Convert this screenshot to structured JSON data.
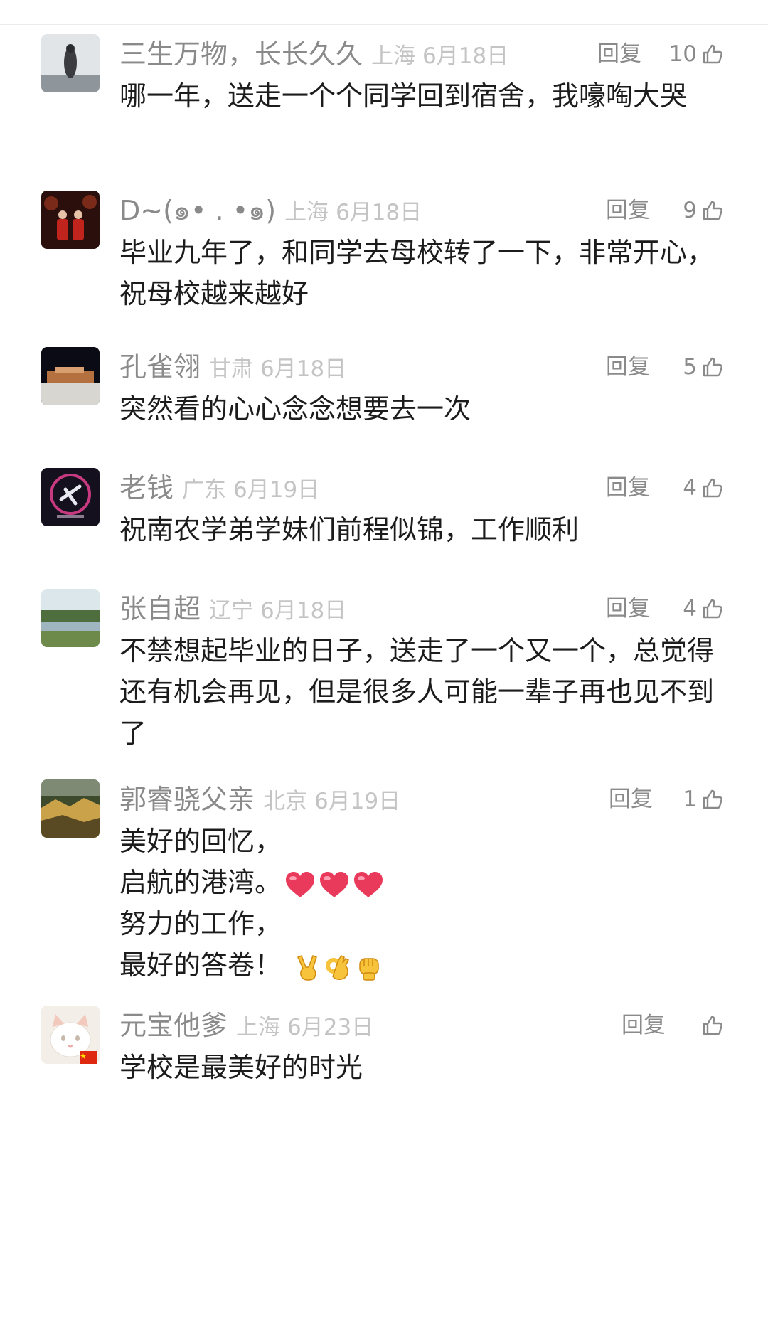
{
  "comments": [
    {
      "username": "三生万物，长长久久",
      "location": "上海",
      "date": "6月18日",
      "reply_label": "回复",
      "likes": "10",
      "text": "哪一年，送走一个个同学回到宿舍，我嚎啕大哭",
      "avatar_colors": [
        "#dfe3e6",
        "#7c858c"
      ]
    },
    {
      "username": "D~(๑• . •๑)",
      "location": "上海",
      "date": "6月18日",
      "reply_label": "回复",
      "likes": "9",
      "text": "毕业九年了，和同学去母校转了一下，非常开心，祝母校越来越好",
      "avatar_colors": [
        "#3a1410",
        "#b3201a"
      ]
    },
    {
      "username": "孔雀翎",
      "location": "甘肃",
      "date": "6月18日",
      "reply_label": "回复",
      "likes": "5",
      "text": "突然看的心心念念想要去一次",
      "avatar_colors": [
        "#0c0c18",
        "#c88a5a"
      ]
    },
    {
      "username": "老钱",
      "location": "广东",
      "date": "6月19日",
      "reply_label": "回复",
      "likes": "4",
      "text": "祝南农学弟学妹们前程似锦，工作顺利",
      "avatar_colors": [
        "#120f1c",
        "#c83a80"
      ]
    },
    {
      "username": "张自超",
      "location": "辽宁",
      "date": "6月18日",
      "reply_label": "回复",
      "likes": "4",
      "text": "不禁想起毕业的日子，送走了一个又一个，总觉得还有机会再见，但是很多人可能一辈子再也见不到了",
      "avatar_colors": [
        "#dbe6ea",
        "#5e7e46"
      ]
    },
    {
      "username": "郭睿骁父亲",
      "location": "北京",
      "date": "6月19日",
      "reply_label": "回复",
      "likes": "1",
      "text_lines": [
        "美好的回忆，",
        "启航的港湾。",
        "努力的工作，",
        "最好的答卷！"
      ],
      "emojis_line2": [
        "red-heart",
        "red-heart",
        "red-heart"
      ],
      "emojis_line4": [
        "victory-hand",
        "ok-hand",
        "raised-fist"
      ],
      "avatar_colors": [
        "#3d4a2c",
        "#c9a24a"
      ]
    },
    {
      "username": "元宝他爹",
      "location": "上海",
      "date": "6月23日",
      "reply_label": "回复",
      "likes": "",
      "text": "学校是最美好的时光",
      "avatar_colors": [
        "#f4efe8",
        "#e8b7a8"
      ]
    }
  ],
  "colors": {
    "username": "#8a8a8a",
    "meta": "#c4c4c4",
    "body_text": "#1c1c1c",
    "heart": "#ea3a5c",
    "hand_emoji": "#f6c33a"
  }
}
